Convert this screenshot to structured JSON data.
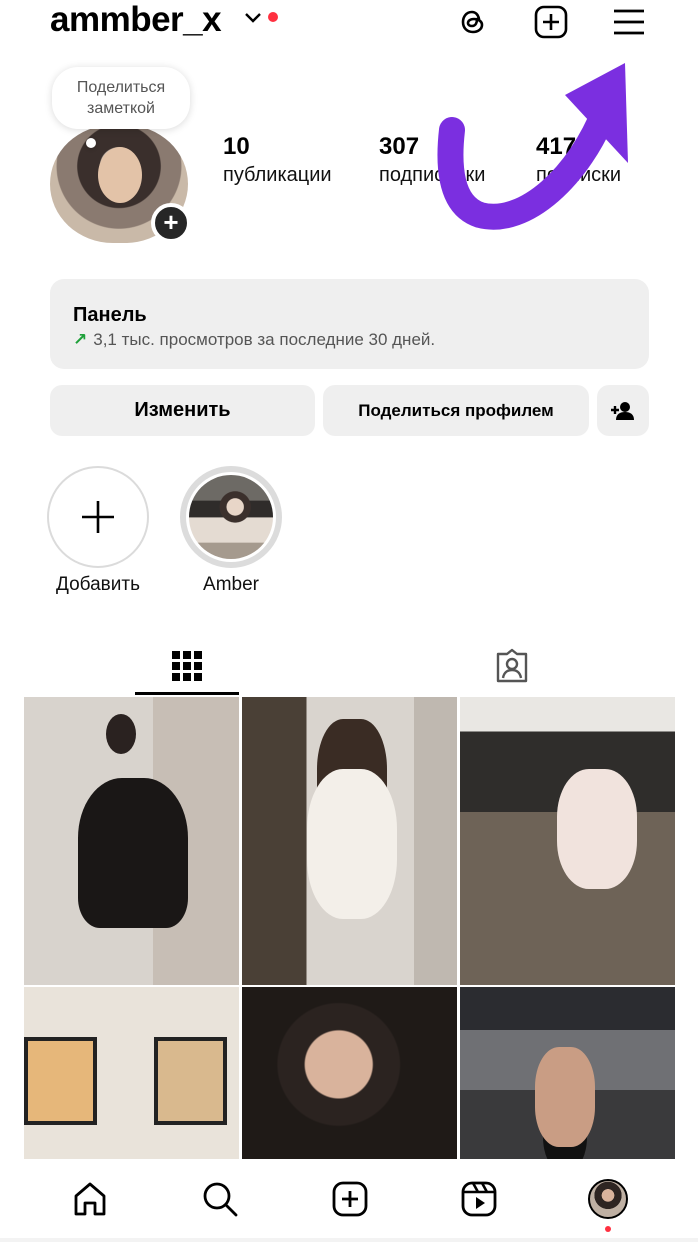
{
  "header": {
    "username": "ammber_x",
    "icons": [
      "threads-icon",
      "create-icon",
      "menu-icon"
    ],
    "notification_color": "#ff3040"
  },
  "profile": {
    "note_prompt": "Поделиться заметкой",
    "stats": [
      {
        "value": "10",
        "label": "публикации"
      },
      {
        "value": "307",
        "label": "подписчики"
      },
      {
        "value": "417",
        "label": "подписки"
      }
    ]
  },
  "dashboard": {
    "title": "Панель",
    "trend_icon": "↗",
    "subtitle": "3,1 тыс. просмотров за последние 30 дней."
  },
  "actions": {
    "edit": "Изменить",
    "share": "Поделиться профилем",
    "discover_icon": "add-person-icon"
  },
  "highlights": [
    {
      "label": "Добавить",
      "type": "new"
    },
    {
      "label": "Amber",
      "type": "story"
    }
  ],
  "tabs": [
    "posts-grid-icon",
    "tagged-icon"
  ],
  "posts_count_visible": 6,
  "bottom_nav": [
    "home-icon",
    "search-icon",
    "create-icon",
    "reels-icon",
    "profile-avatar"
  ],
  "colors": {
    "accent_annotation": "#7b2fe0",
    "trend_green": "#1ea03a",
    "button_bg": "#efefef"
  }
}
